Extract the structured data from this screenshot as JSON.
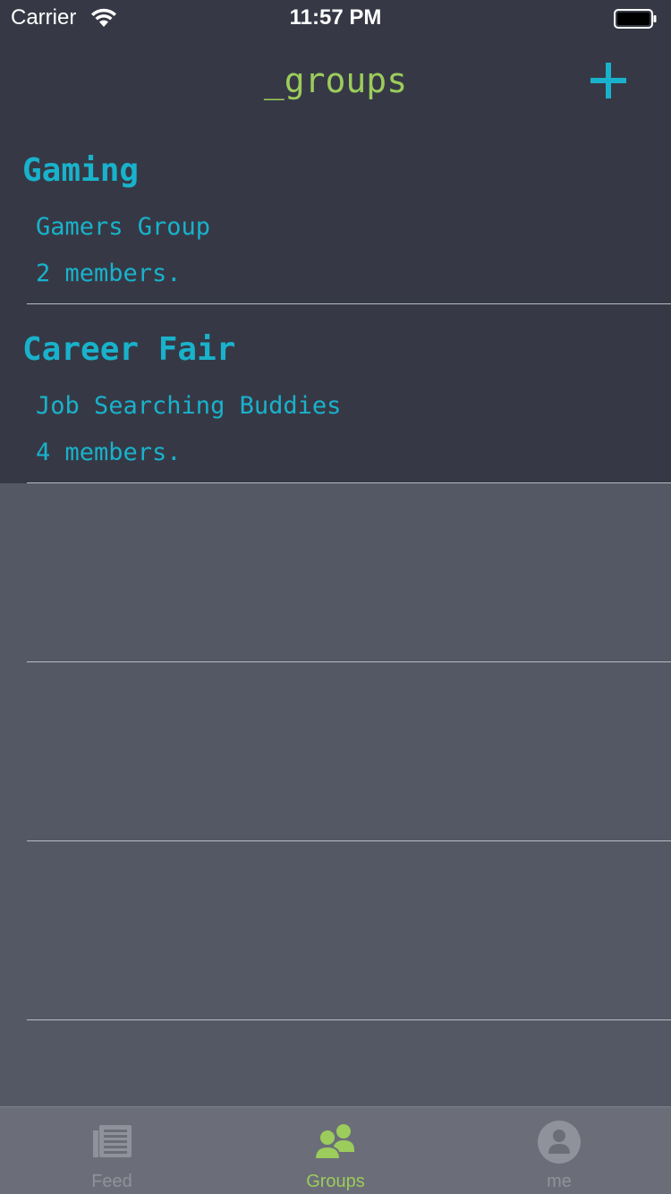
{
  "status_bar": {
    "carrier": "Carrier",
    "time": "11:57 PM",
    "wifi_icon": "wifi-icon",
    "battery_icon": "battery-icon"
  },
  "nav": {
    "title": "_groups",
    "add_icon": "plus-icon"
  },
  "groups": [
    {
      "event": "Gaming",
      "name": "Gamers Group",
      "members": "2 members."
    },
    {
      "event": "Career Fair",
      "name": "Job Searching Buddies",
      "members": "4 members."
    }
  ],
  "tab_bar": {
    "tabs": [
      {
        "label": "Feed",
        "icon": "newspaper-icon",
        "active": false
      },
      {
        "label": "Groups",
        "icon": "people-icon",
        "active": true
      },
      {
        "label": "me",
        "icon": "user-circle-icon",
        "active": false
      }
    ]
  },
  "colors": {
    "header_bg": "#363945",
    "content_bg": "#545864",
    "accent_cyan": "#19b2cc",
    "accent_green": "#9ccc5c",
    "tab_bar_bg": "#6b6e78",
    "tab_inactive": "#8f929b"
  }
}
